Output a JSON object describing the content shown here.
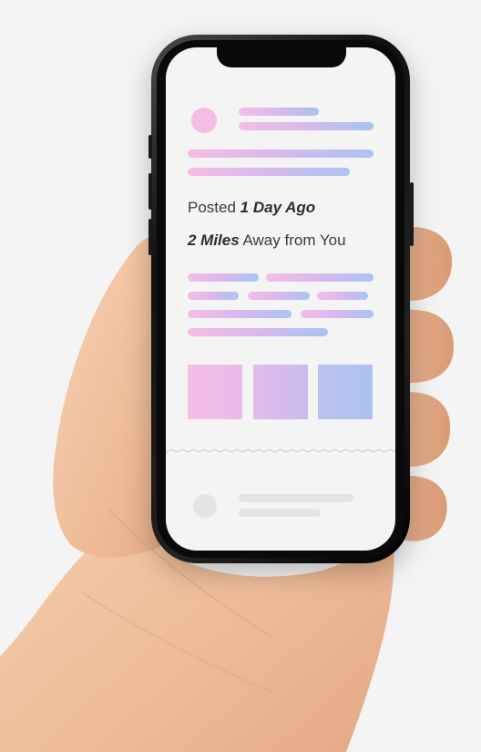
{
  "post": {
    "posted_prefix": "Posted ",
    "posted_value": "1 Day Ago",
    "distance_value": "2 Miles",
    "distance_suffix": " Away from You"
  },
  "colors": {
    "gradient_start": "#f5bde6",
    "gradient_mid": "#d8b8ec",
    "gradient_end": "#a9c3f0",
    "placeholder_gray": "#e4e4e4",
    "screen_background": "#f4f4f4",
    "phone_body": "#111111",
    "skin": "#f0c4a4"
  },
  "icons": {
    "avatar": "avatar-placeholder-icon",
    "next_avatar": "avatar-placeholder-icon"
  }
}
